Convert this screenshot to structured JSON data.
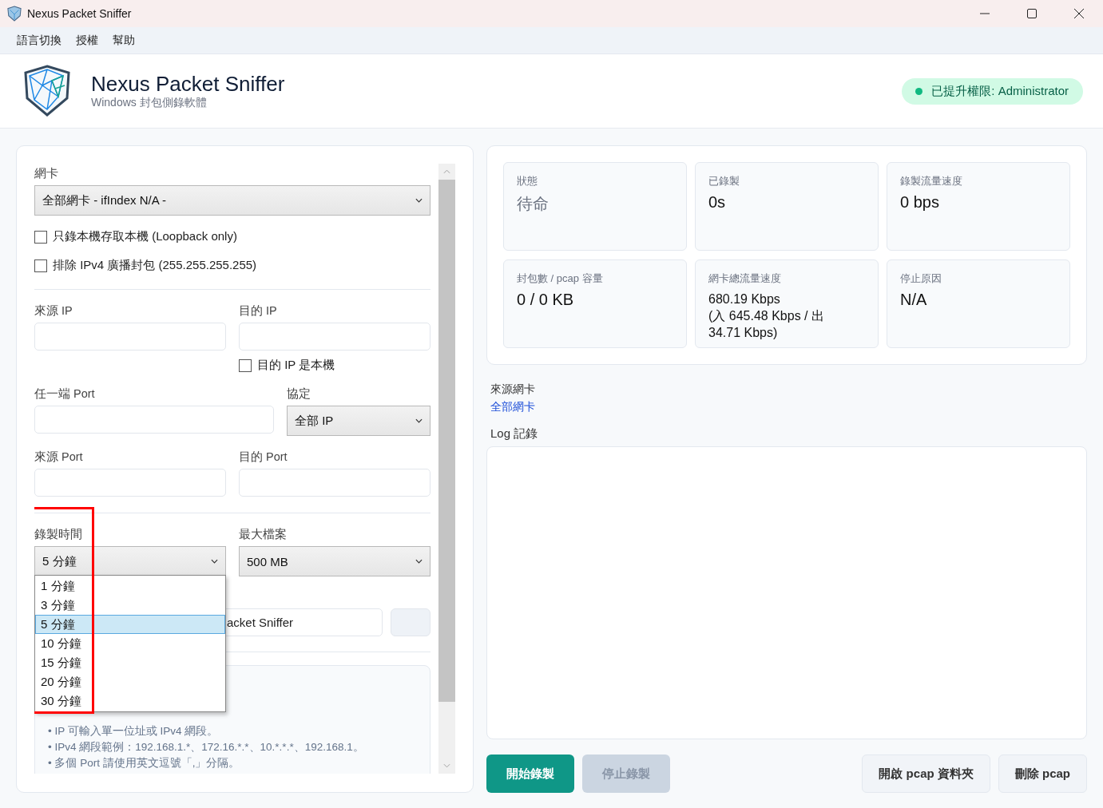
{
  "window": {
    "title": "Nexus Packet Sniffer"
  },
  "menu_bar": {
    "items": [
      "語言切換",
      "授權",
      "幫助"
    ]
  },
  "header": {
    "title": "Nexus Packet Sniffer",
    "subtitle": "Windows 封包側錄軟體",
    "badge": {
      "text": "已提升權限: Administrator",
      "color": "#10b981"
    }
  },
  "capture_form": {
    "adapter": {
      "label": "網卡",
      "value": "全部網卡 - ifIndex N/A -"
    },
    "adapter_options": [
      {
        "label": "只錄本機存取本機 (Loopback only)",
        "checked": false
      },
      {
        "label": "排除 IPv4 廣播封包 (255.255.255.255)",
        "checked": false
      }
    ],
    "source_ip": {
      "label": "來源 IP"
    },
    "dest_ip": {
      "label": "目的 IP"
    },
    "dest_is_local": {
      "label": "目的 IP 是本機",
      "checked": false
    },
    "any_port": {
      "label": "任一端 Port"
    },
    "protocol": {
      "label": "協定",
      "value": "全部 IP"
    },
    "source_port": {
      "label": "來源 Port"
    },
    "dest_port": {
      "label": "目的 Port"
    },
    "recording_time": {
      "label": "錄製時間",
      "value": "5 分鐘",
      "expanded": true,
      "options": [
        {
          "label": "1 分鐘",
          "selected": false
        },
        {
          "label": "3 分鐘",
          "selected": false
        },
        {
          "label": "5 分鐘",
          "selected": true
        },
        {
          "label": "10 分鐘",
          "selected": false
        },
        {
          "label": "15 分鐘",
          "selected": false
        },
        {
          "label": "20 分鐘",
          "selected": false
        },
        {
          "label": "30 分鐘",
          "selected": false
        }
      ]
    },
    "max_file": {
      "label": "最大檔案",
      "value": "500 MB"
    },
    "output_path": {
      "value": "acket Sniffer"
    },
    "notes": [
      "• IP 可輸入單一位址或 IPv4 網段。",
      "• IPv4 網段範例：192.168.1.*、172.16.*.*、10.*.*.*、192.168.1。",
      "• 多個 Port 請使用英文逗號「,」分隔。"
    ]
  },
  "stats": [
    {
      "label": "狀態",
      "value": "待命",
      "kind": "status"
    },
    {
      "label": "已錄製",
      "value": "0s",
      "kind": "value"
    },
    {
      "label": "錄製流量速度",
      "value": "0 bps",
      "kind": "value"
    },
    {
      "label": "封包數 / pcap 容量",
      "value": "0 / 0 KB",
      "kind": "value"
    },
    {
      "label": "網卡總流量速度",
      "value": "680.19 Kbps\n(入 645.48 Kbps / 出 34.71 Kbps)",
      "kind": "detail"
    },
    {
      "label": "停止原因",
      "value": "N/A",
      "kind": "value"
    }
  ],
  "source_adapter": {
    "label": "來源網卡",
    "value": "全部網卡"
  },
  "log": {
    "label": "Log 記錄"
  },
  "actions": [
    {
      "label": "開始錄製",
      "kind": "primary",
      "disabled": false
    },
    {
      "label": "停止錄製",
      "kind": "primary",
      "disabled": true
    },
    {
      "label": "開啟 pcap 資料夾",
      "kind": "secondary",
      "disabled": false
    },
    {
      "label": "刪除 pcap",
      "kind": "secondary",
      "disabled": false
    }
  ]
}
